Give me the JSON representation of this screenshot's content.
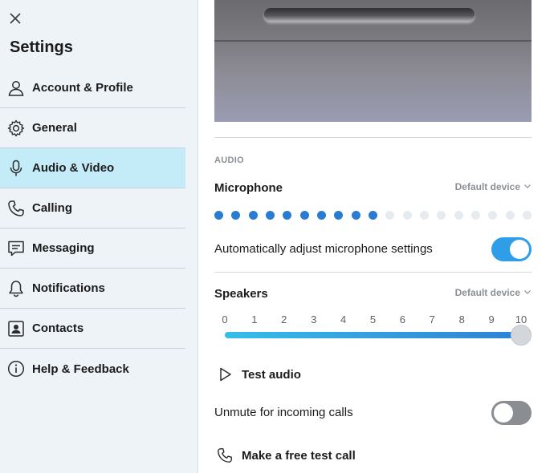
{
  "sidebar": {
    "close_icon": "close-icon",
    "title": "Settings",
    "items": [
      {
        "label": "Account & Profile",
        "icon": "person-icon",
        "active": false
      },
      {
        "label": "General",
        "icon": "gear-icon",
        "active": false
      },
      {
        "label": "Audio & Video",
        "icon": "microphone-icon",
        "active": true
      },
      {
        "label": "Calling",
        "icon": "phone-icon",
        "active": false
      },
      {
        "label": "Messaging",
        "icon": "chat-icon",
        "active": false
      },
      {
        "label": "Notifications",
        "icon": "bell-icon",
        "active": false
      },
      {
        "label": "Contacts",
        "icon": "contact-card-icon",
        "active": false
      },
      {
        "label": "Help & Feedback",
        "icon": "info-icon",
        "active": false
      }
    ]
  },
  "audio": {
    "section_label": "AUDIO",
    "microphone": {
      "title": "Microphone",
      "device": "Default device",
      "level_dots_total": 19,
      "level_dots_active": 10
    },
    "auto_adjust": {
      "label": "Automatically adjust microphone settings",
      "enabled": true
    },
    "speakers": {
      "title": "Speakers",
      "device": "Default device",
      "scale": [
        "0",
        "1",
        "2",
        "3",
        "4",
        "5",
        "6",
        "7",
        "8",
        "9",
        "10"
      ],
      "volume": 10
    },
    "test_audio": {
      "label": "Test audio",
      "icon": "play-icon"
    },
    "unmute_incoming": {
      "label": "Unmute for incoming calls",
      "enabled": false
    },
    "test_call": {
      "label": "Make a free test call",
      "icon": "phone-icon"
    }
  },
  "colors": {
    "accent": "#2f9ee8",
    "active_nav": "#c3ecf8",
    "mic_dot_on": "#2a7bd2",
    "mic_dot_off": "#e6ebef",
    "toggle_off": "#8a8d91"
  }
}
